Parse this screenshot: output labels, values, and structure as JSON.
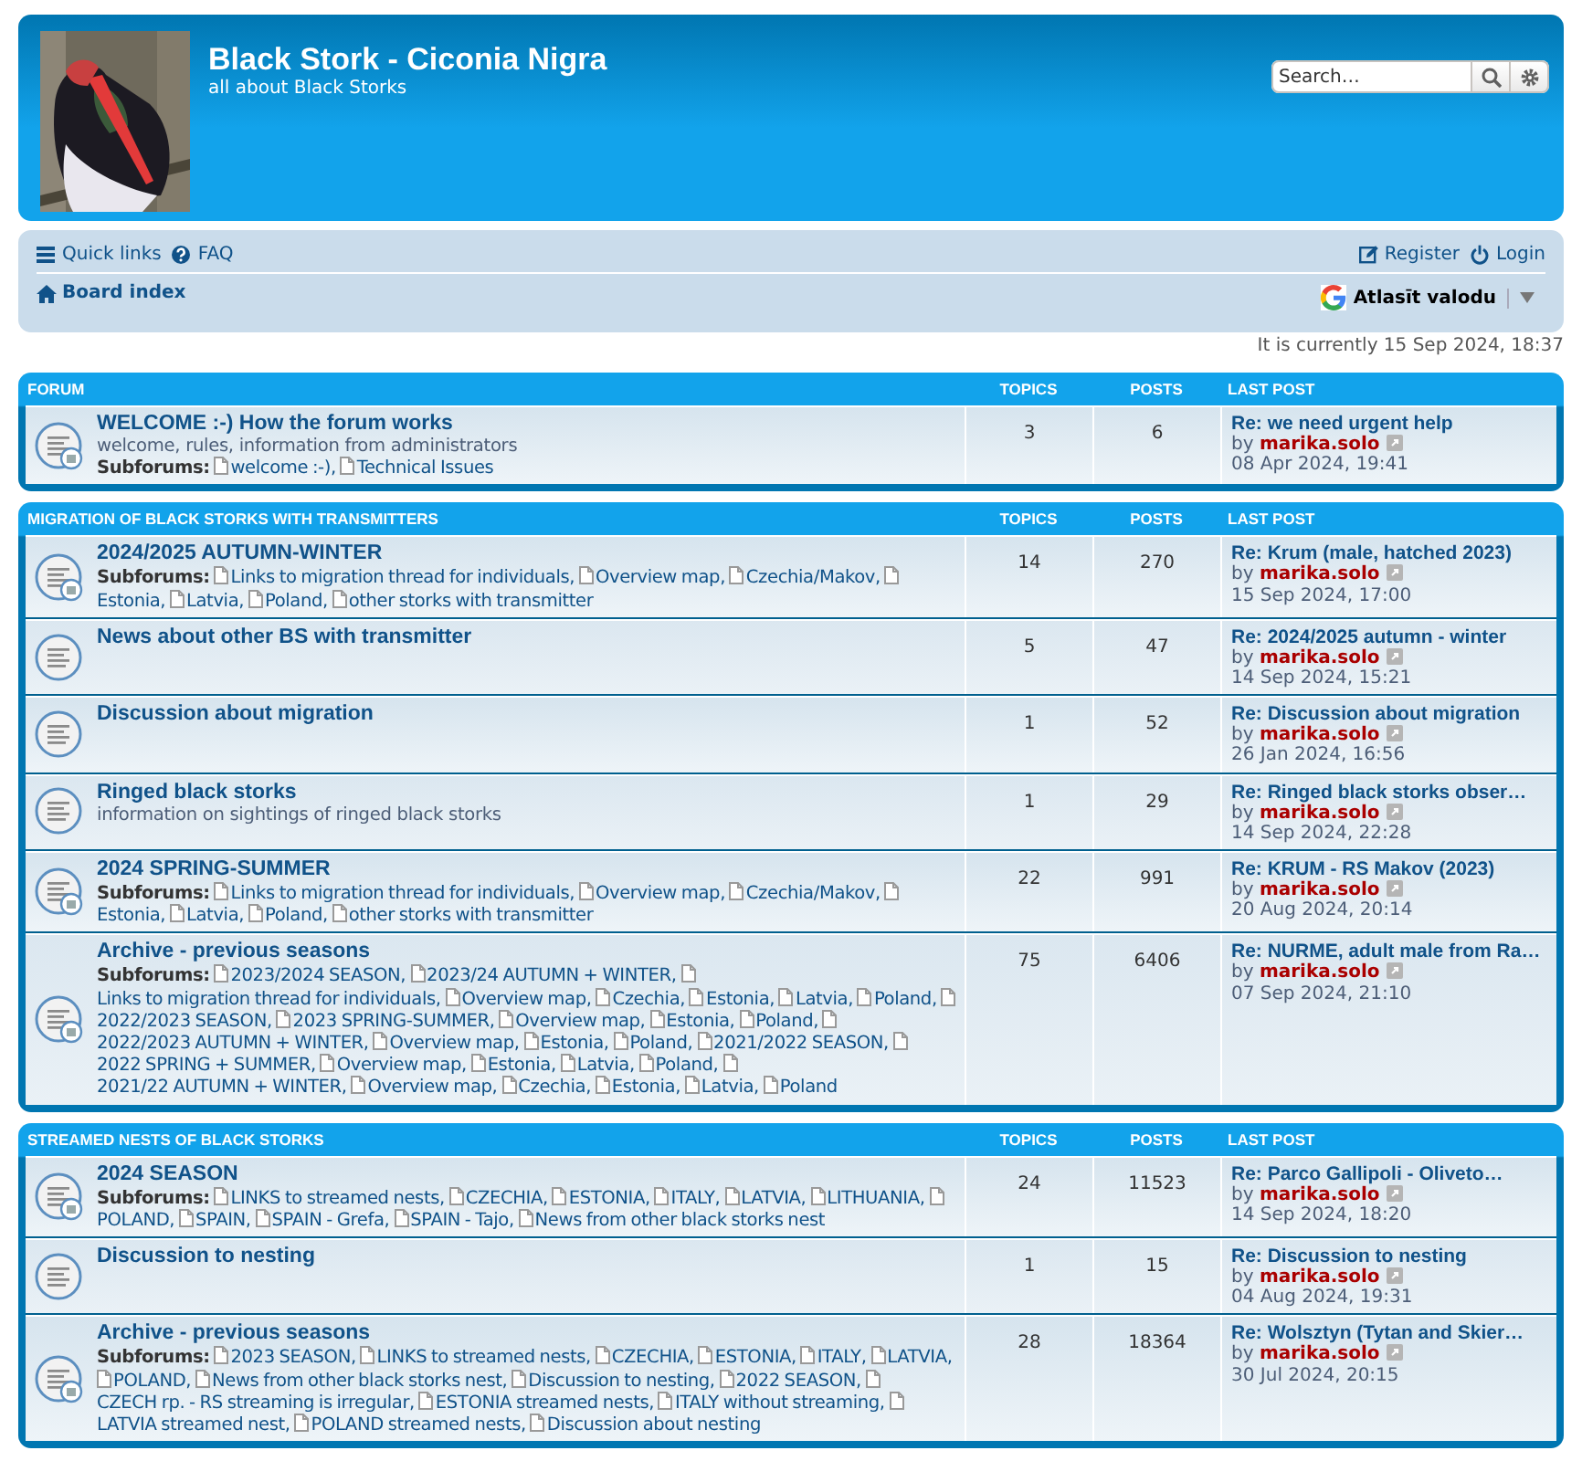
{
  "header": {
    "site_title": "Black Stork - Ciconia Nigra",
    "site_description": "all about Black Storks",
    "search": {
      "placeholder": "Search…"
    }
  },
  "nav": {
    "links": [
      {
        "kind": "menu",
        "label": "Quick links"
      },
      {
        "kind": "help",
        "label": "FAQ"
      }
    ],
    "user_links": [
      {
        "kind": "register",
        "label": "Register"
      },
      {
        "kind": "login",
        "label": "Login"
      }
    ],
    "breadcrumb": "Board index",
    "translate": "Atlasīt valodu"
  },
  "current_time": "It is currently 15 Sep 2024, 18:37",
  "categories": [
    {
      "title": "FORUM",
      "columns": [
        "TOPICS",
        "POSTS",
        "LAST POST"
      ],
      "forums": [
        {
          "title": "WELCOME :-) How the forum works",
          "description": "welcome, rules, information from administrators",
          "subforums_label": "Subforums:",
          "subforums": [
            "welcome :-),",
            "Technical Issues"
          ],
          "topics": "3",
          "posts": "6",
          "last_post": {
            "title": "Re: we need urgent help",
            "by": "by",
            "author": "marika.solo",
            "date": "08 Apr 2024, 19:41"
          }
        }
      ]
    },
    {
      "title": "MIGRATION OF BLACK STORKS WITH TRANSMITTERS",
      "columns": [
        "TOPICS",
        "POSTS",
        "LAST POST"
      ],
      "forums": [
        {
          "title": "2024/2025 AUTUMN-WINTER",
          "subforums_label": "Subforums:",
          "subforums": [
            "Links to migration thread for individuals,",
            "Overview map,",
            "Czechia/Makov,",
            "Estonia,",
            "Latvia,",
            "Poland,",
            "other storks with transmitter"
          ],
          "topics": "14",
          "posts": "270",
          "last_post": {
            "title": "Re: Krum (male, hatched 2023)",
            "by": "by",
            "author": "marika.solo",
            "date": "15 Sep 2024, 17:00"
          }
        },
        {
          "title": "News about other BS with transmitter",
          "topics": "5",
          "posts": "47",
          "last_post": {
            "title": "Re: 2024/2025 autumn - winter",
            "by": "by",
            "author": "marika.solo",
            "date": "14 Sep 2024, 15:21"
          }
        },
        {
          "title": "Discussion about migration",
          "topics": "1",
          "posts": "52",
          "last_post": {
            "title": "Re: Discussion about migration",
            "by": "by",
            "author": "marika.solo",
            "date": "26 Jan 2024, 16:56"
          }
        },
        {
          "title": "Ringed black storks",
          "description": "information on sightings of ringed black storks",
          "topics": "1",
          "posts": "29",
          "last_post": {
            "title": "Re: Ringed black storks obser…",
            "by": "by",
            "author": "marika.solo",
            "date": "14 Sep 2024, 22:28"
          }
        },
        {
          "title": "2024 SPRING-SUMMER",
          "subforums_label": "Subforums:",
          "subforums": [
            "Links to migration thread for individuals,",
            "Overview map,",
            "Czechia/Makov,",
            "Estonia,",
            "Latvia,",
            "Poland,",
            "other storks with transmitter"
          ],
          "topics": "22",
          "posts": "991",
          "last_post": {
            "title": "Re: KRUM - RS Makov (2023)",
            "by": "by",
            "author": "marika.solo",
            "date": "20 Aug 2024, 20:14"
          }
        },
        {
          "title": "Archive - previous seasons",
          "subforums_label": "Subforums:",
          "subforums": [
            "2023/2024 SEASON,",
            "2023/24 AUTUMN + WINTER,",
            "Links to migration thread for individuals,",
            "Overview map,",
            "Czechia,",
            "Estonia,",
            "Latvia,",
            "Poland,",
            "2022/2023 SEASON,",
            "2023 SPRING-SUMMER,",
            "Overview map,",
            "Estonia,",
            "Poland,",
            "2022/2023 AUTUMN + WINTER,",
            "Overview map,",
            "Estonia,",
            "Poland,",
            "2021/2022 SEASON,",
            "2022 SPRING + SUMMER,",
            "Overview map,",
            "Estonia,",
            "Latvia,",
            "Poland,",
            "2021/22 AUTUMN + WINTER,",
            "Overview map,",
            "Czechia,",
            "Estonia,",
            "Latvia,",
            "Poland"
          ],
          "topics": "75",
          "posts": "6406",
          "last_post": {
            "title": "Re: NURME, adult male from Ra…",
            "by": "by",
            "author": "marika.solo",
            "date": "07 Sep 2024, 21:10"
          }
        }
      ]
    },
    {
      "title": "STREAMED NESTS OF BLACK STORKS",
      "columns": [
        "TOPICS",
        "POSTS",
        "LAST POST"
      ],
      "forums": [
        {
          "title": "2024 SEASON",
          "subforums_label": "Subforums:",
          "subforums": [
            "LINKS to streamed nests,",
            "CZECHIA,",
            "ESTONIA,",
            "ITALY,",
            "LATVIA,",
            "LITHUANIA,",
            "POLAND,",
            "SPAIN,",
            "SPAIN - Grefa,",
            "SPAIN - Tajo,",
            "News from other black storks nest"
          ],
          "topics": "24",
          "posts": "11523",
          "last_post": {
            "title": "Re: Parco Gallipoli - Oliveto…",
            "by": "by",
            "author": "marika.solo",
            "date": "14 Sep 2024, 18:20"
          }
        },
        {
          "title": "Discussion to nesting",
          "topics": "1",
          "posts": "15",
          "last_post": {
            "title": "Re: Discussion to nesting",
            "by": "by",
            "author": "marika.solo",
            "date": "04 Aug 2024, 19:31"
          }
        },
        {
          "title": "Archive - previous seasons",
          "subforums_label": "Subforums:",
          "subforums": [
            "2023 SEASON,",
            "LINKS to streamed nests,",
            "CZECHIA,",
            "ESTONIA,",
            "ITALY,",
            "LATVIA,",
            "POLAND,",
            "News from other black storks nest,",
            "Discussion to nesting,",
            "2022 SEASON,",
            "CZECH rp. - RS streaming is irregular,",
            "ESTONIA streamed nests,",
            "ITALY without streaming,",
            "LATVIA streamed nest,",
            "POLAND streamed nests,",
            "Discussion about nesting"
          ],
          "topics": "28",
          "posts": "18364",
          "last_post": {
            "title": "Re: Wolsztyn (Tytan and Skier…",
            "by": "by",
            "author": "marika.solo",
            "date": "30 Jul 2024, 20:15"
          }
        }
      ]
    }
  ]
}
